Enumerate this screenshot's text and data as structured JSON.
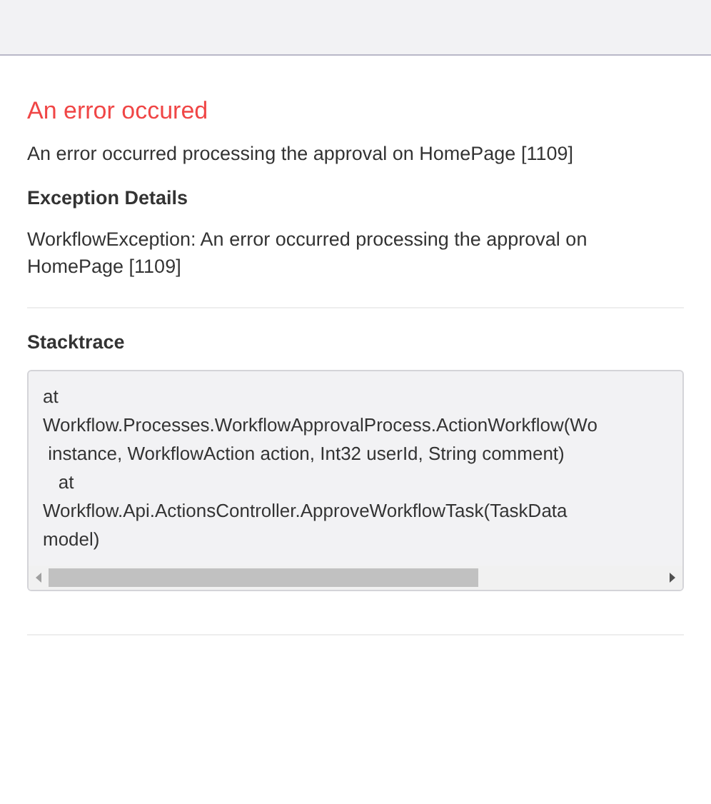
{
  "error": {
    "title": "An error occured",
    "message": "An error occurred processing the approval on HomePage [1109]"
  },
  "exception": {
    "heading": "Exception Details",
    "text": "WorkflowException: An error occurred processing the approval on HomePage [1109]"
  },
  "stacktrace": {
    "heading": "Stacktrace",
    "lines": [
      "at",
      "Workflow.Processes.WorkflowApprovalProcess.ActionWorkflow(Wo",
      " instance, WorkflowAction action, Int32 userId, String comment)",
      "   at",
      "Workflow.Api.ActionsController.ApproveWorkflowTask(TaskData",
      "model)"
    ]
  }
}
